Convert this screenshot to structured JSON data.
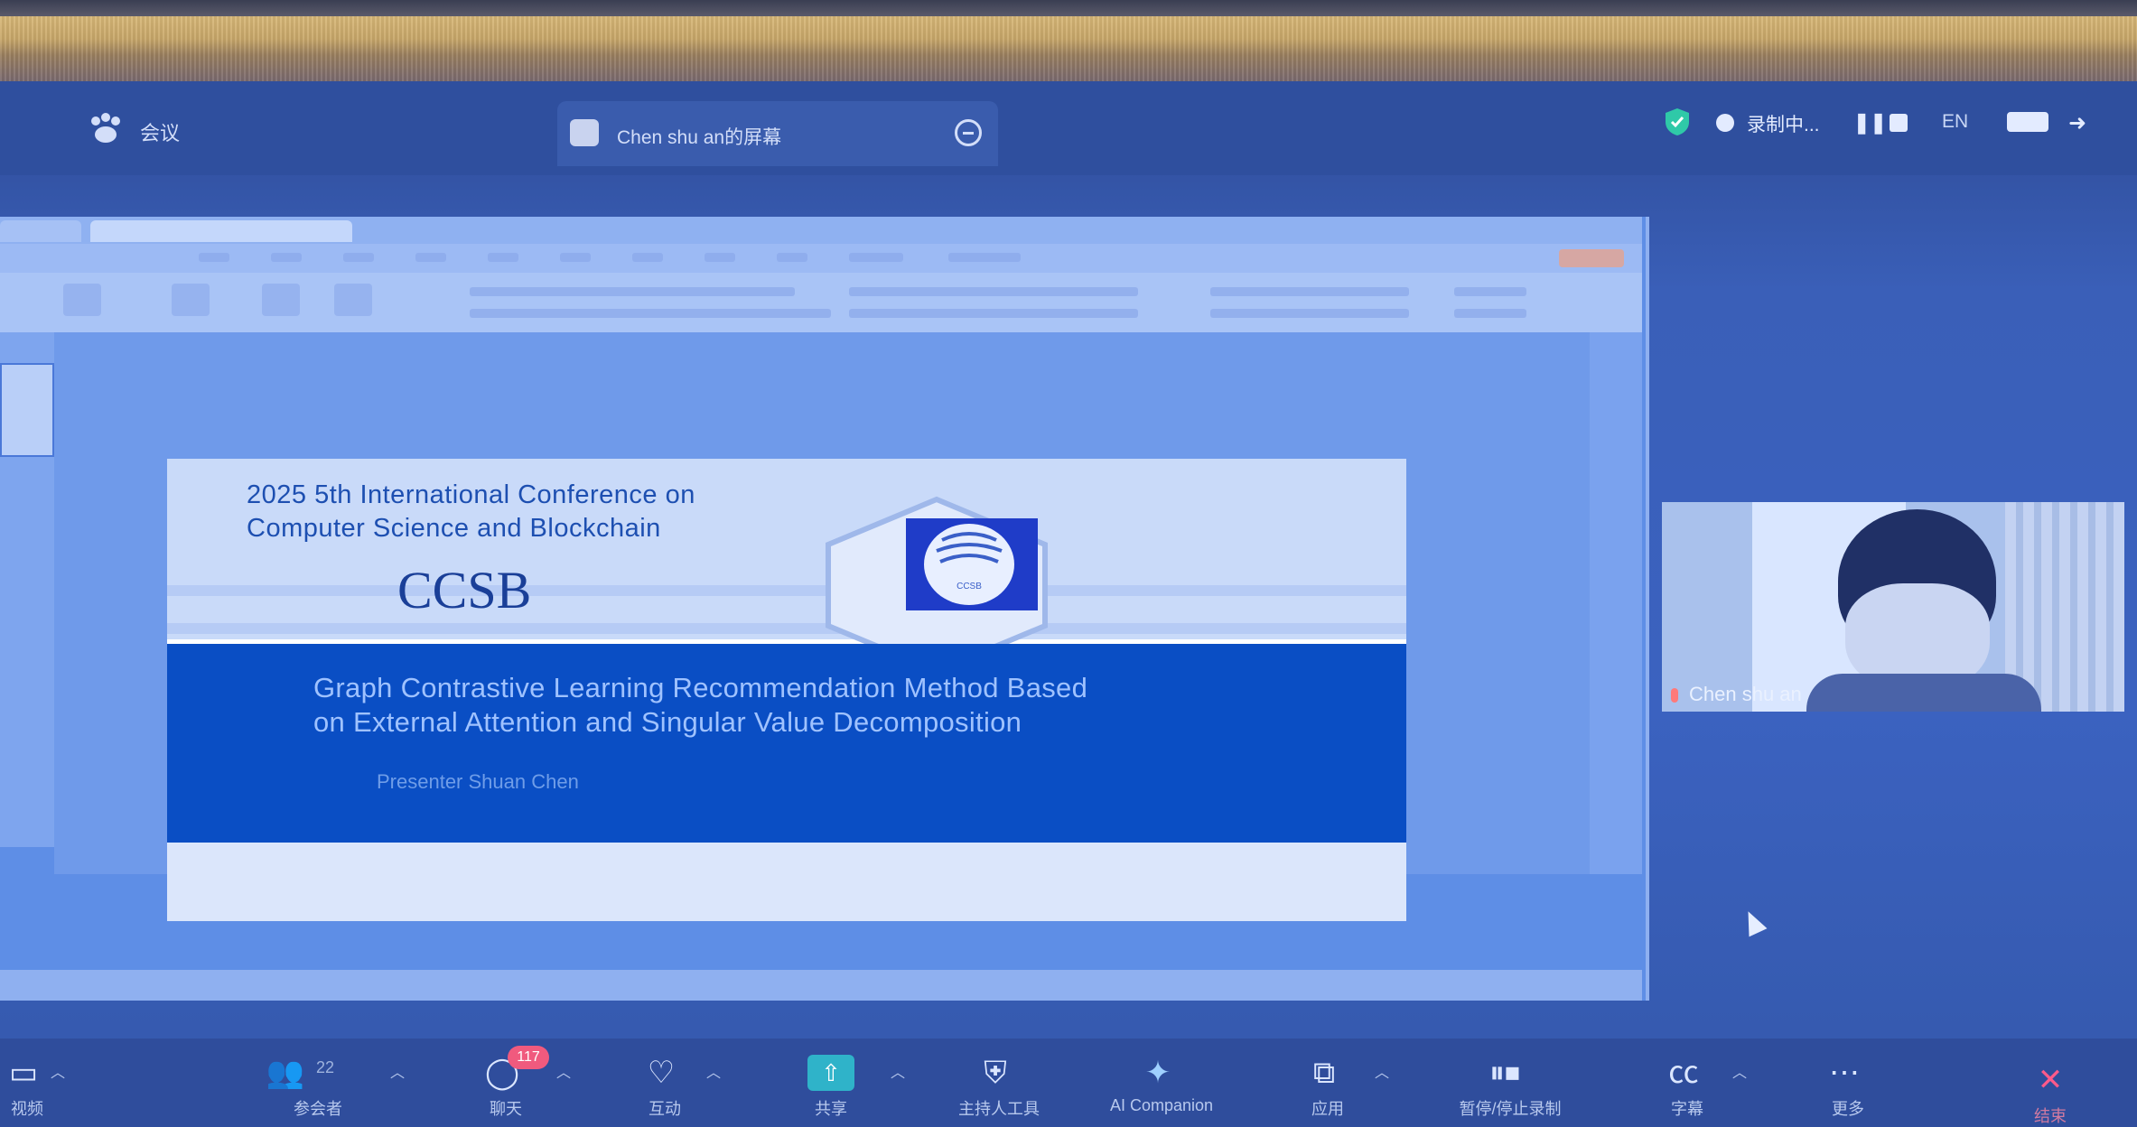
{
  "header": {
    "meeting_label": "会议",
    "share_tab_label": "Chen shu an的屏幕",
    "recording_label": "录制中...",
    "language": "EN"
  },
  "slide": {
    "conference_line1": "2025 5th International Conference on",
    "conference_line2": "Computer Science and Blockchain",
    "acronym": "CCSB",
    "logo_text": "CCSB",
    "paper_title_line1": "Graph Contrastive Learning Recommendation Method Based",
    "paper_title_line2": "on External Attention and Singular Value Decomposition",
    "presenter": "Presenter Shuan Chen"
  },
  "participant": {
    "name": "Chen shu an"
  },
  "toolbar": {
    "items": [
      {
        "icon": "video-camera-icon",
        "label": "视频"
      },
      {
        "icon": "participants-icon",
        "label": "参会者",
        "count": "22"
      },
      {
        "icon": "chat-icon",
        "label": "聊天",
        "badge": "117"
      },
      {
        "icon": "reaction-icon",
        "label": "互动"
      },
      {
        "icon": "share-screen-icon",
        "label": "共享"
      },
      {
        "icon": "ai-host-icon",
        "label": "主持人工具"
      },
      {
        "icon": "ai-companion-icon",
        "label": "AI Companion"
      },
      {
        "icon": "apps-icon",
        "label": "应用"
      },
      {
        "icon": "recording-pause-icon",
        "label": "暂停/停止录制"
      },
      {
        "icon": "captions-icon",
        "label": "字幕"
      },
      {
        "icon": "more-icon",
        "label": "更多"
      }
    ],
    "end_label": "结束"
  },
  "colors": {
    "screen_blue": "#3a5fb8",
    "slide_band": "#0a4ec4",
    "end_button": "#ff5a8a",
    "chat_badge": "#f05a7e"
  }
}
